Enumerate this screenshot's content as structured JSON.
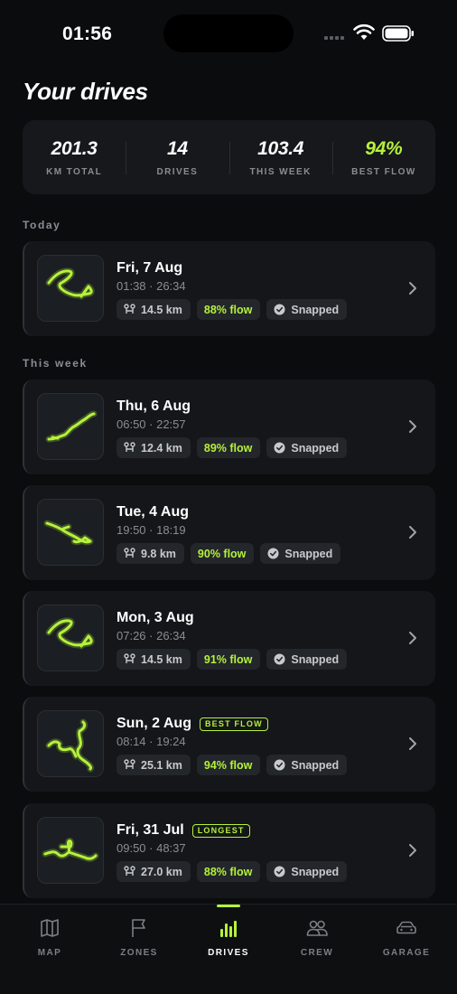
{
  "status_bar": {
    "time": "01:56"
  },
  "page_title": "Your drives",
  "colors": {
    "accent": "#b5f23a",
    "background": "#0b0c0e",
    "card": "#141619"
  },
  "stats": [
    {
      "value": "201.3",
      "label": "KM TOTAL",
      "accent": false
    },
    {
      "value": "14",
      "label": "DRIVES",
      "accent": false
    },
    {
      "value": "103.4",
      "label": "THIS WEEK",
      "accent": false
    },
    {
      "value": "94%",
      "label": "BEST FLOW",
      "accent": true
    }
  ],
  "sections": {
    "today": "Today",
    "this_week": "This week"
  },
  "drives": [
    {
      "date": "Fri, 7 Aug",
      "time": "01:38 · 26:34",
      "distance": "14.5 km",
      "flow": "88% flow",
      "status": "Snapped",
      "badge": "",
      "route_icon": "route-loop-icon"
    },
    {
      "date": "Thu, 6 Aug",
      "time": "06:50 · 22:57",
      "distance": "12.4 km",
      "flow": "89% flow",
      "status": "Snapped",
      "badge": "",
      "route_icon": "route-diagonal-icon"
    },
    {
      "date": "Tue, 4 Aug",
      "time": "19:50 · 18:19",
      "distance": "9.8 km",
      "flow": "90% flow",
      "status": "Snapped",
      "badge": "",
      "route_icon": "route-descending-icon"
    },
    {
      "date": "Mon, 3 Aug",
      "time": "07:26 · 26:34",
      "distance": "14.5 km",
      "flow": "91% flow",
      "status": "Snapped",
      "badge": "",
      "route_icon": "route-loop-icon"
    },
    {
      "date": "Sun, 2 Aug",
      "time": "08:14 · 19:24",
      "distance": "25.1 km",
      "flow": "94% flow",
      "status": "Snapped",
      "badge": "BEST FLOW",
      "route_icon": "route-winding-icon"
    },
    {
      "date": "Fri, 31 Jul",
      "time": "09:50 · 48:37",
      "distance": "27.0 km",
      "flow": "88% flow",
      "status": "Snapped",
      "badge": "LONGEST",
      "route_icon": "route-branch-icon"
    }
  ],
  "tabs": [
    {
      "label": "MAP",
      "icon": "map-icon",
      "active": false
    },
    {
      "label": "ZONES",
      "icon": "flag-icon",
      "active": false
    },
    {
      "label": "DRIVES",
      "icon": "bar-chart-icon",
      "active": true
    },
    {
      "label": "CREW",
      "icon": "people-icon",
      "active": false
    },
    {
      "label": "GARAGE",
      "icon": "car-icon",
      "active": false
    }
  ]
}
